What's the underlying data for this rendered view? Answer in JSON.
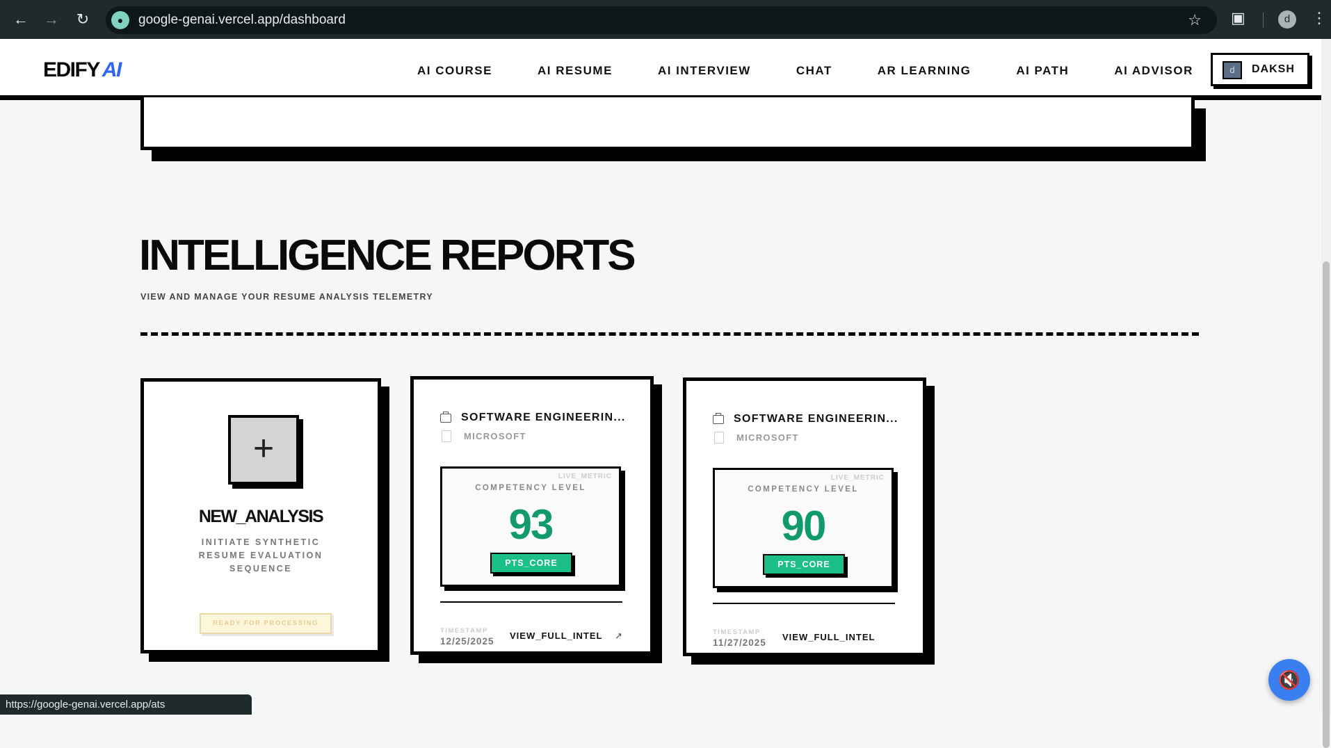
{
  "browser": {
    "url": "google-genai.vercel.app/dashboard",
    "status_url": "https://google-genai.vercel.app/ats",
    "profile_initial": "d"
  },
  "app": {
    "logo_text": "EDIFY",
    "logo_accent": "AI",
    "nav": [
      "AI COURSE",
      "AI RESUME",
      "AI INTERVIEW",
      "CHAT",
      "AR LEARNING",
      "AI PATH",
      "AI ADVISOR"
    ],
    "user": {
      "initial": "d",
      "name": "DAKSH"
    }
  },
  "section": {
    "title": "INTELLIGENCE REPORTS",
    "subtitle": "VIEW AND MANAGE YOUR RESUME ANALYSIS TELEMETRY"
  },
  "new_analysis": {
    "plus": "+",
    "title": "NEW_ANALYSIS",
    "description": "INITIATE SYNTHETIC RESUME EVALUATION SEQUENCE",
    "status_button": "READY FOR PROCESSING"
  },
  "reports": [
    {
      "title": "SOFTWARE ENGINEERIN...",
      "company": "MICROSOFT",
      "metric_tag": "LIVE_METRIC",
      "metric_label": "COMPETENCY LEVEL",
      "score": "93",
      "score_unit": "PTS_CORE",
      "timestamp_label": "TIMESTAMP",
      "timestamp": "12/25/2025",
      "action": "VIEW_FULL_INTEL"
    },
    {
      "title": "SOFTWARE ENGINEERIN...",
      "company": "MICROSOFT",
      "metric_tag": "LIVE_METRIC",
      "metric_label": "COMPETENCY LEVEL",
      "score": "90",
      "score_unit": "PTS_CORE",
      "timestamp_label": "TIMESTAMP",
      "timestamp": "11/27/2025",
      "action": "VIEW_FULL_INTEL"
    }
  ],
  "colors": {
    "accent_blue": "#2f66f5",
    "score_green": "#129a6c",
    "pts_green": "#1cbf86",
    "fab_blue": "#3a7ff0"
  },
  "icons": {
    "fab": "mic-off-icon",
    "report": "briefcase-icon",
    "company": "building-icon",
    "action_arrow": "trending-up-icon"
  }
}
